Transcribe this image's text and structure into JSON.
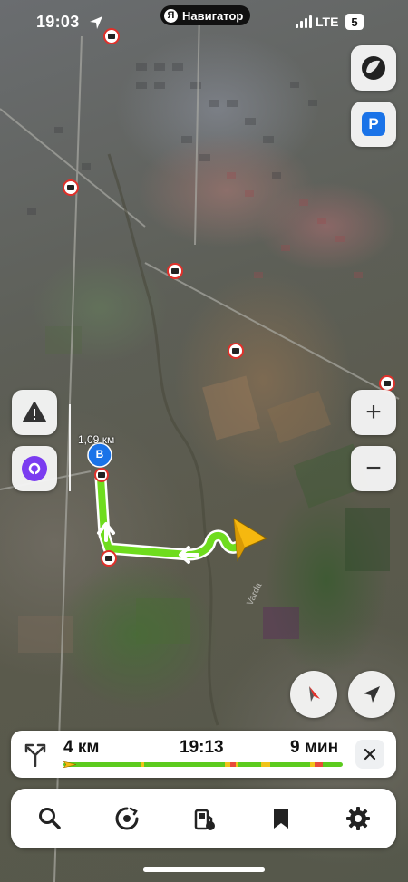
{
  "status_bar": {
    "time": "19:03",
    "app_badge_letter": "Я",
    "app_name": "Навигатор",
    "network": "LTE",
    "battery": "5"
  },
  "map": {
    "distance_label": "1,09 км",
    "destination_marker": "B",
    "road_label": "Varda",
    "icons": [
      "speed-camera-icon",
      "navigation-arrow-icon",
      "destination-pin-icon"
    ]
  },
  "side_buttons": {
    "parking_label": "P",
    "zoom_in_label": "+",
    "zoom_out_label": "−",
    "alert_icon": "warning-triangle-icon",
    "assistant_icon": "alice-assistant-icon",
    "compass_icon": "compass-icon",
    "locate_icon": "my-location-arrow-icon",
    "layers_icon": "map-layers-icon"
  },
  "route_panel": {
    "distance": "4 км",
    "arrival_time": "19:13",
    "duration": "9 мин",
    "close_icon": "close-icon",
    "alternative_icon": "route-fork-icon",
    "colors": {
      "free": "#5ccb1e",
      "slow": "#f0c419",
      "jam": "#e84b3a"
    }
  },
  "toolbar": {
    "items": [
      {
        "name": "search",
        "icon": "search-icon"
      },
      {
        "name": "music",
        "icon": "music-player-icon"
      },
      {
        "name": "gas-stations",
        "icon": "gas-station-icon"
      },
      {
        "name": "bookmarks",
        "icon": "bookmark-icon"
      },
      {
        "name": "settings",
        "icon": "gear-icon"
      }
    ]
  },
  "colors": {
    "route_green": "#6fdc1e",
    "accent_blue": "#1a73e8",
    "alice_purple": "#7b3cf0",
    "camera_red": "#e0302a"
  }
}
